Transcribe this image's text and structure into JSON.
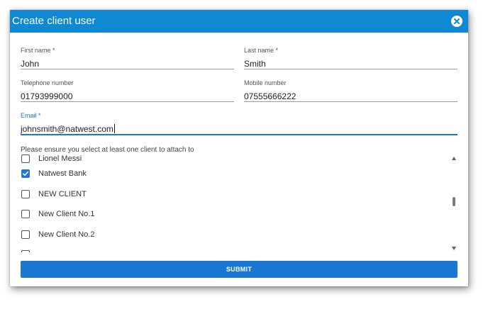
{
  "dialog": {
    "title": "Create client user"
  },
  "form": {
    "first_name": {
      "label": "First name *",
      "value": "John"
    },
    "last_name": {
      "label": "Last name *",
      "value": "Smith"
    },
    "telephone": {
      "label": "Telephone number",
      "value": "01793999000"
    },
    "mobile": {
      "label": "Mobile number",
      "value": "07555666222"
    },
    "email": {
      "label": "Email *",
      "value": "johnsmith@natwest.com"
    }
  },
  "clients": {
    "hint": "Please ensure you select at least one client to attach to",
    "items": [
      {
        "label": "Lionel Messi",
        "checked": false
      },
      {
        "label": "Natwest Bank",
        "checked": true
      },
      {
        "label": "NEW CLIENT",
        "checked": false
      },
      {
        "label": "New Client No.1",
        "checked": false
      },
      {
        "label": "New Client No.2",
        "checked": false
      }
    ]
  },
  "submit_label": "SUBMIT",
  "colors": {
    "header": "#0f8ad2",
    "accent": "#1f77d3",
    "button": "#1a78d4"
  },
  "icons": {
    "close": "close-icon",
    "checkbox_checked": "checkmark-icon",
    "scroll_up": "arrow-up-icon",
    "scroll_down": "arrow-down-icon"
  }
}
